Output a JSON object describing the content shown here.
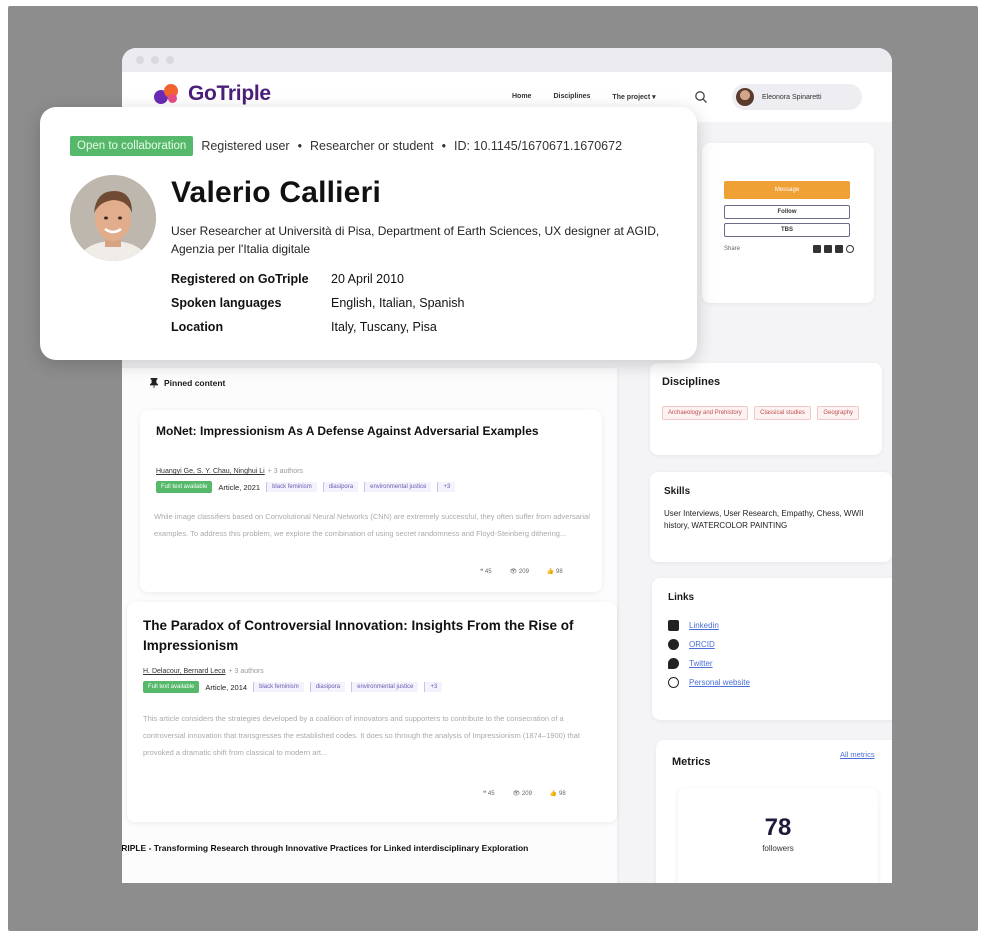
{
  "logo": {
    "text": "GoTriple"
  },
  "nav": {
    "links": [
      "Home",
      "Disciplines",
      "The project ▾"
    ],
    "user_name": "Eleonora Spinaretti"
  },
  "profile": {
    "badge": "Open to collaboration",
    "status": "Registered user",
    "sep1": "•",
    "kind": "Researcher or student",
    "sep2": "•",
    "id": "ID: 10.1145/1670671.1670672",
    "name": "Valerio Callieri",
    "role": "User Researcher at Università di Pisa, Department of Earth Sciences, UX designer at AGID, Agenzia per l'Italia digitale",
    "info": [
      {
        "key": "Registered on GoTriple",
        "value": "20 April 2010"
      },
      {
        "key": "Spoken languages",
        "value": "English, Italian, Spanish"
      },
      {
        "key": "Location",
        "value": "Italy, Tuscany, Pisa"
      }
    ]
  },
  "actions": {
    "message": "Message",
    "follow": "Follow",
    "third": "TBS",
    "share": "Share"
  },
  "pinned": {
    "title": "Pinned content"
  },
  "publications": [
    {
      "title": "MoNet: Impressionism As A Defense Against Adversarial Examples",
      "authors": "Huangyi Ge, S. Y. Chau, Ninghui Li",
      "more_authors": "+ 3 authors",
      "access": "Full text available",
      "type": "Article, 2021",
      "tags": [
        "black feminism",
        "diasipora",
        "environmental justice",
        "+3"
      ],
      "abstract": "While image classifiers based on Convolutional Neural Networks (CNN) are extremely successful, they often suffer from adversarial examples. To address this problem, we explore the combination of using secret randomness and Floyd-Steinberg dithering...",
      "stats": {
        "quotes": "45",
        "views": "209",
        "likes": "98"
      }
    },
    {
      "title": "The Paradox of Controversial Innovation: Insights From the Rise of Impressionism",
      "authors": "H. Delacour, Bernard Leca",
      "more_authors": "+ 3 authors",
      "access": "Full text available",
      "type": "Article, 2014",
      "tags": [
        "black feminism",
        "diasipora",
        "environmental justice",
        "+3"
      ],
      "abstract": "This article considers the strategies developed by a coalition of innovators and supporters to contribute to the consecration of a controversial innovation that transgresses the established codes. It does so through the analysis of Impressionism (1874–1900) that provoked a dramatic shift from classical to modern art...",
      "stats": {
        "quotes": "45",
        "views": "209",
        "likes": "98"
      }
    }
  ],
  "project_title": "TRIPLE - Transforming Research through Innovative Practices for Linked interdisciplinary Exploration",
  "disciplines": {
    "title": "Disciplines",
    "tags": [
      "Archaeology and Prehistory",
      "Classical studies",
      "Geography"
    ]
  },
  "skills": {
    "title": "Skills",
    "text": "User Interviews, User Research, Empathy, Chess, WWII history, WATERCOLOR PAINTING"
  },
  "links": {
    "title": "Links",
    "items": [
      "Linkedin",
      "ORCID",
      "Twitter",
      "Personal website"
    ]
  },
  "metrics": {
    "title": "Metrics",
    "all_link": "All metrics",
    "value": "78",
    "label": "followers"
  },
  "colors": {
    "brand": "#4a1f7a",
    "accent": "#f0a136",
    "green": "#55b86a",
    "link": "#4b6fd8"
  }
}
